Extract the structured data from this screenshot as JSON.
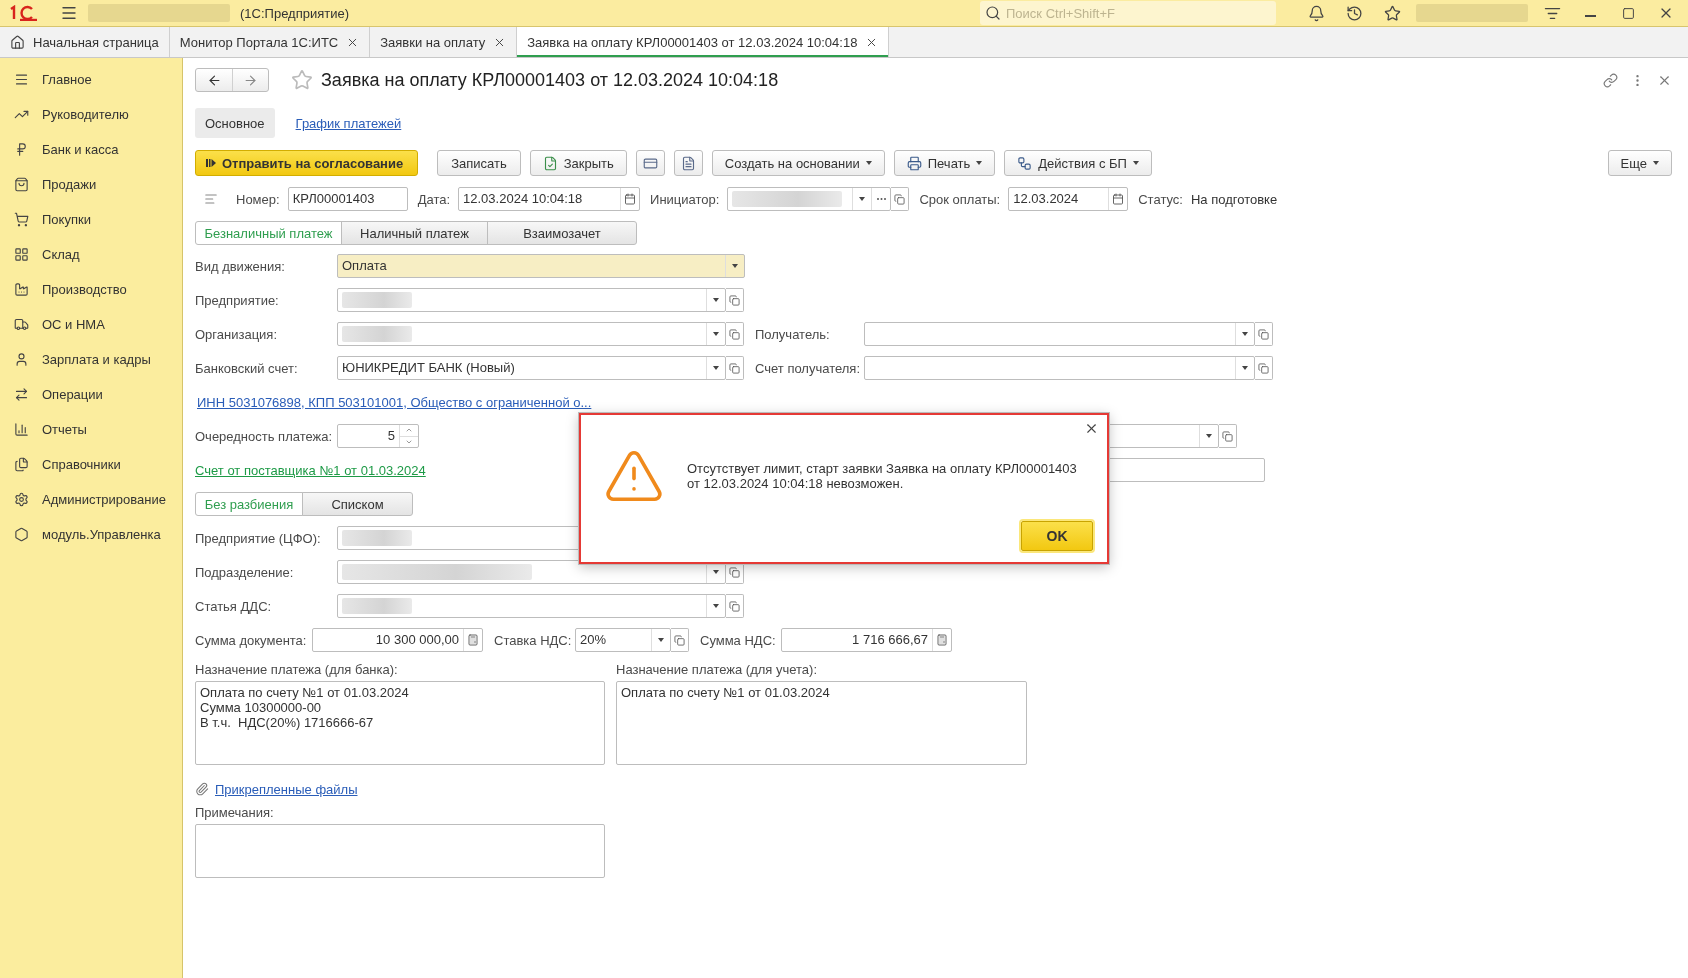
{
  "app": {
    "name_redacted": true,
    "title": "(1С:Предприятие)",
    "search": {
      "placeholder": "Поиск Ctrl+Shift+F"
    },
    "user_redacted": true
  },
  "open_tabs": [
    {
      "kind": "home",
      "label": "Начальная страница",
      "selected": false
    },
    {
      "kind": "document",
      "label": "Монитор Портала 1С:ИТС",
      "selected": false
    },
    {
      "kind": "document",
      "label": "Заявки на оплату",
      "selected": false
    },
    {
      "kind": "document",
      "label": "Заявка на оплату КРЛ00001403 от 12.03.2024 10:04:18",
      "selected": true
    }
  ],
  "sidebar": {
    "items": [
      "Главное",
      "Руководителю",
      "Банк и касса",
      "Продажи",
      "Покупки",
      "Склад",
      "Производство",
      "ОС и НМА",
      "Зарплата и кадры",
      "Операции",
      "Отчеты",
      "Справочники",
      "Администрирование",
      "модуль.Управленка"
    ]
  },
  "document": {
    "title": "Заявка на оплату КРЛ00001403 от 12.03.2024 10:04:18",
    "views": [
      {
        "label": "Основное",
        "selected": true
      },
      {
        "label": "График платежей",
        "selected": false
      }
    ],
    "commands": [
      {
        "kind": "primary",
        "label": "Отправить на согласование"
      },
      {
        "kind": "plain",
        "label": "Записать"
      },
      {
        "kind": "plain",
        "label": "Закрыть"
      },
      {
        "kind": "icon"
      },
      {
        "kind": "icon"
      },
      {
        "kind": "menu",
        "label": "Создать на основании"
      },
      {
        "kind": "menu",
        "label": "Печать"
      },
      {
        "kind": "menu",
        "label": "Действия с БП"
      }
    ],
    "more_button": "Еще",
    "header": {
      "number": {
        "label": "Номер:",
        "value": "КРЛ00001403"
      },
      "date": {
        "label": "Дата:",
        "value": "12.03.2024 10:04:18"
      },
      "initiator": {
        "label": "Инициатор:",
        "redacted": true
      },
      "due": {
        "label": "Срок оплаты:",
        "value": "12.03.2024"
      },
      "status": {
        "label": "Статус:",
        "value": "На подготовке"
      }
    },
    "payment_types": [
      {
        "label": "Безналичный платеж",
        "selected": true
      },
      {
        "label": "Наличный платеж",
        "selected": false
      },
      {
        "label": "Взаимозачет",
        "selected": false
      }
    ],
    "movement": {
      "label": "Вид движения:",
      "value": "Оплата",
      "highlighted": true
    },
    "enterprise": {
      "label": "Предприятие:",
      "redacted": true
    },
    "organization": {
      "label": "Организация:",
      "redacted": true
    },
    "recipient": {
      "label": "Получатель:"
    },
    "bank_account": {
      "label": "Банковский счет:",
      "value": "ЮНИКРЕДИТ БАНК (Новый)"
    },
    "recipient_account": {
      "label": "Счет получателя:"
    },
    "inn_link": "ИНН 5031076898, КПП 503101001, Общество с ограниченной о...",
    "priority": {
      "label": "Очередность платежа:",
      "value": "5"
    },
    "invoice_link": "Счет от поставщика №1 от 01.03.2024",
    "split_modes": [
      {
        "label": "Без разбиения",
        "selected": true
      },
      {
        "label": "Списком",
        "selected": false
      }
    ],
    "cfo": {
      "label": "Предприятие (ЦФО):",
      "redacted": true
    },
    "department": {
      "label": "Подразделение:",
      "redacted": true
    },
    "cash_item": {
      "label": "Статья ДДС:",
      "redacted": true
    },
    "amount": {
      "label": "Сумма документа:",
      "value": "10 300 000,00"
    },
    "vat_rate": {
      "label": "Ставка НДС:",
      "value": "20%"
    },
    "vat_amount": {
      "label": "Сумма НДС:",
      "value": "1 716 666,67"
    },
    "purpose_bank": {
      "label": "Назначение платежа (для банка):",
      "value": "Оплата по счету №1 от 01.03.2024\nСумма 10300000-00\nВ т.ч.  НДС(20%) 1716666-67"
    },
    "purpose_accounting": {
      "label": "Назначение платежа (для учета):",
      "value": "Оплата по счету №1 от 01.03.2024"
    },
    "attachments_link": "Прикрепленные файлы",
    "notes": {
      "label": "Примечания:"
    }
  },
  "dialog": {
    "message": "Отсутствует лимит, старт заявки Заявка на оплату КРЛ00001403 от 12.03.2024 10:04:18 невозможен.",
    "ok": "OK"
  }
}
